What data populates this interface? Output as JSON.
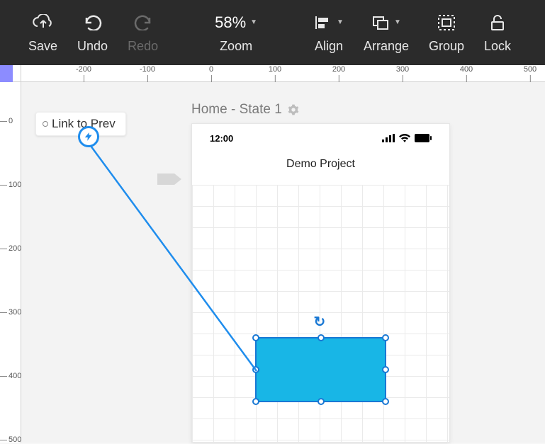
{
  "toolbar": {
    "save": "Save",
    "undo": "Undo",
    "redo": "Redo",
    "zoom_value": "58%",
    "zoom_label": "Zoom",
    "align": "Align",
    "arrange": "Arrange",
    "group": "Group",
    "lock": "Lock"
  },
  "ruler_h": {
    "ticks": [
      "-200",
      "-100",
      "0",
      "100",
      "200",
      "300",
      "400",
      "500"
    ]
  },
  "ruler_v": {
    "ticks": [
      "0",
      "100",
      "200",
      "300",
      "400",
      "500"
    ]
  },
  "page": {
    "title": "Home - State 1"
  },
  "device": {
    "time": "12:00",
    "project_title": "Demo Project"
  },
  "link_prev": {
    "label": "Link to Prev"
  },
  "colors": {
    "accent": "#1f8ded",
    "shape_fill": "#18b6e6",
    "shape_border": "#1978d4"
  }
}
